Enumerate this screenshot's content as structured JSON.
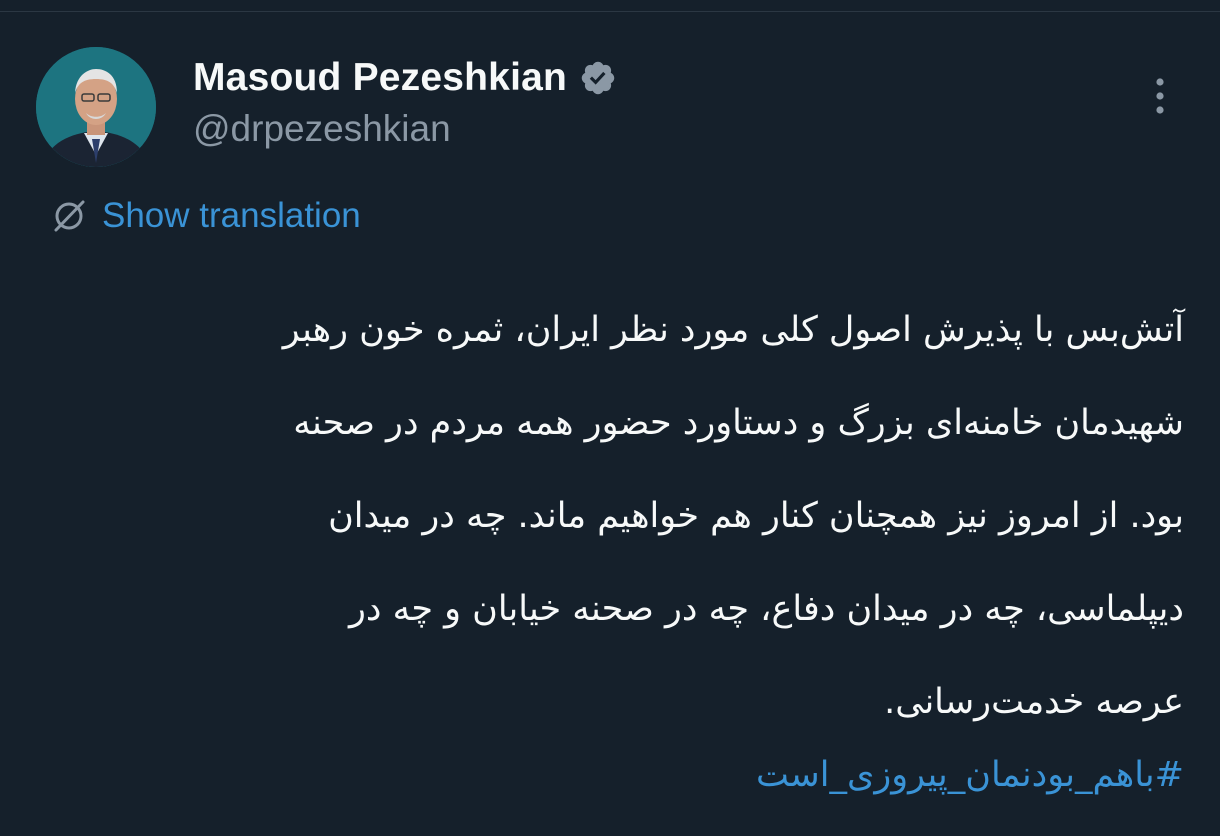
{
  "author": {
    "display_name": "Masoud Pezeshkian",
    "handle": "@drpezeshkian"
  },
  "icons": {
    "verified": "verified-badge-icon",
    "more": "more-vertical-icon",
    "translate": "translate-globe-icon"
  },
  "translation": {
    "label": "Show translation"
  },
  "tweet": {
    "lines": [
      "آتش‌بس با پذیرش اصول کلی مورد نظر ایران، ثمره خون رهبر",
      "شهیدمان خامنه‌ای بزرگ و دستاورد حضور همه مردم در صحنه",
      "بود. از امروز نیز همچنان کنار هم خواهیم ماند. چه در میدان",
      "دیپلماسی، چه در میدان دفاع، چه در صحنه خیابان و چه در",
      "عرصه خدمت‌رسانی."
    ],
    "hashtag": "#باهم_بودنمان_پیروزی_است"
  },
  "colors": {
    "background": "#15202b",
    "primary_text": "#f7f9f9",
    "secondary_text": "#8b98a5",
    "link": "#3a93d6",
    "verified_badge": "#8b98a5"
  }
}
